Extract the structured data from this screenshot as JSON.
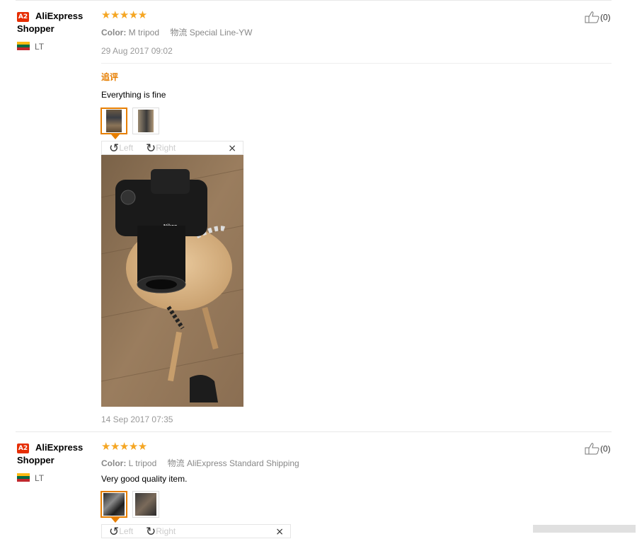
{
  "reviews": [
    {
      "badge": "A2",
      "user_line1": "AliExpress",
      "user_line2": "Shopper",
      "country": "LT",
      "stars": "★★★★★",
      "color_label": "Color:",
      "color_value": "M tripod",
      "logistics_label": "物流",
      "logistics_value": "Special Line-YW",
      "date": "29 Aug 2017 09:02",
      "likes": "(0)",
      "followup_label": "追评",
      "followup_text": "Everything is fine",
      "followup_date": "14 Sep 2017 07:35",
      "viewer": {
        "left_label": "Left",
        "right_label": "Right",
        "close": "×"
      }
    },
    {
      "badge": "A2",
      "user_line1": "AliExpress",
      "user_line2": "Shopper",
      "country": "LT",
      "stars": "★★★★★",
      "color_label": "Color:",
      "color_value": "L tripod",
      "logistics_label": "物流",
      "logistics_value": "AliExpress Standard Shipping",
      "text": "Very good quality item.",
      "likes": "(0)",
      "viewer": {
        "left_label": "Left",
        "right_label": "Right",
        "close": "×"
      }
    }
  ],
  "colors": {
    "accent": "#e67e00",
    "badge": "#e62e04",
    "stars": "#f5a623"
  },
  "icons": [
    "thumbs-up-icon",
    "rotate-left-icon",
    "rotate-right-icon",
    "close-icon",
    "flag-icon"
  ]
}
